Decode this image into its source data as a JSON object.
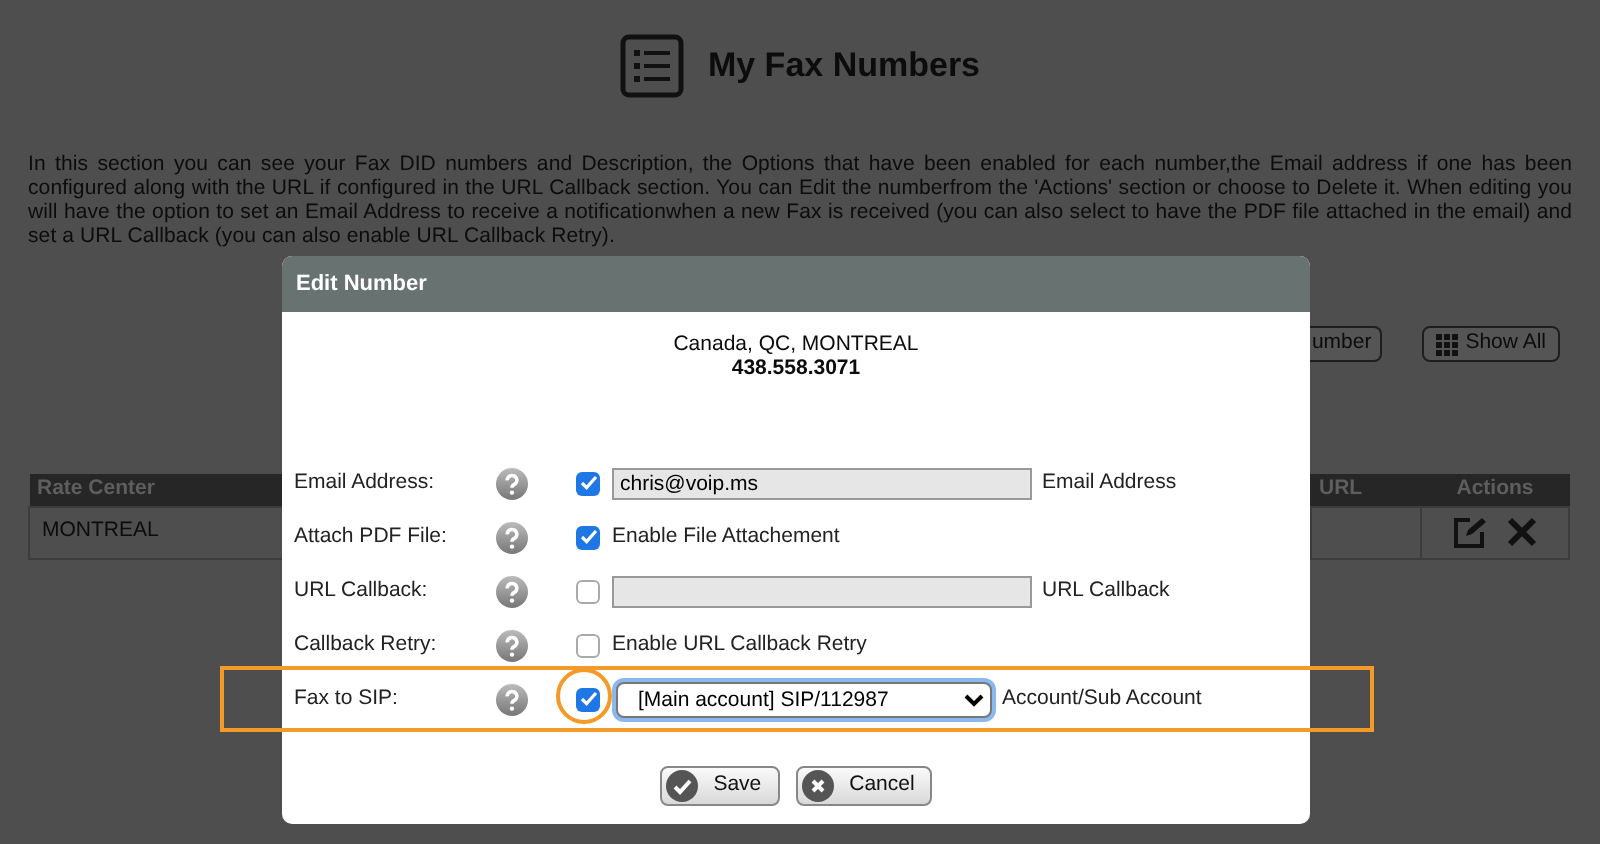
{
  "page": {
    "title": "My Fax Numbers",
    "description": "In this section you can see your Fax DID numbers and Description, the Options that have been enabled for each number,the Email address if one has been configured along with the URL if configured in the URL Callback section. You can Edit the numberfrom the 'Actions' section or choose to Delete it. When editing you will have the option to set an Email Address to receive a notificationwhen a new Fax is received (you can also select to have the PDF file attached in the email) and set a URL Callback (you can also enable URL Callback Retry)."
  },
  "toolbar": {
    "buttons": [
      {
        "label": "umber",
        "kind": "plain"
      },
      {
        "label": "Show All",
        "kind": "grid"
      }
    ]
  },
  "table": {
    "columns": [
      "Rate Center",
      "URL",
      "Actions"
    ],
    "rows": [
      {
        "rate_center": "MONTREAL"
      }
    ]
  },
  "dialog": {
    "title": "Edit Number",
    "location": "Canada, QC, MONTREAL",
    "number": "438.558.3071",
    "fields": [
      {
        "label": "Email Address:",
        "kind": "text",
        "checked": true,
        "value": "chris@voip.ms",
        "suffix": "Email Address",
        "highlighted": false
      },
      {
        "label": "Attach PDF File:",
        "kind": "check",
        "checked": true,
        "caption": "Enable File Attachement",
        "highlighted": false
      },
      {
        "label": "URL Callback:",
        "kind": "text",
        "checked": false,
        "suffix": "URL Callback",
        "highlighted": false
      },
      {
        "label": "Callback Retry:",
        "kind": "check",
        "checked": false,
        "caption": "Enable URL Callback Retry",
        "highlighted": false
      },
      {
        "label": "Fax to SIP:",
        "kind": "select",
        "checked": true,
        "value": "[Main account] SIP/112987",
        "suffix": "Account/Sub Account",
        "highlighted": true
      }
    ],
    "buttons": [
      {
        "label": "Save",
        "kind": "ok"
      },
      {
        "label": "Cancel",
        "kind": "cancel"
      }
    ]
  }
}
